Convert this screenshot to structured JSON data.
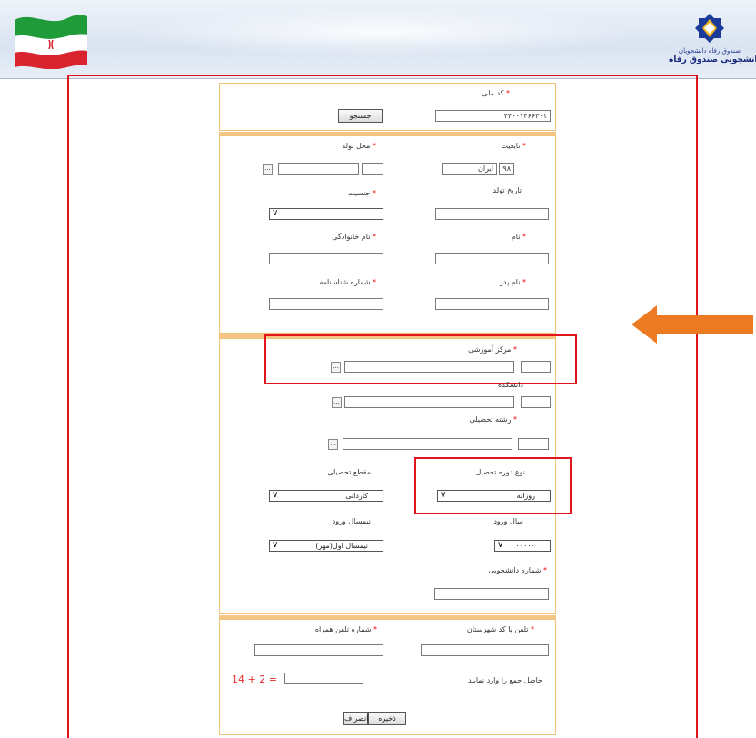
{
  "header": {
    "logo_line1": "صندوق رفاه دانشجویان",
    "logo_line2": "پورتال دانشجویی صندوق رفاه"
  },
  "search": {
    "national_code_label": "کد ملی",
    "national_code_value": "۰۴۴۰۰۱۴۶۶۳۰۱",
    "search_button": "جستجو"
  },
  "personal": {
    "nationality_label": "تابعیت",
    "nationality_code": "۹۸",
    "nationality_value": "ایران",
    "birthplace_label": "محل تولد",
    "birthdate_label": "تاریخ تولد",
    "gender_label": "جنسیت",
    "first_name_label": "نام",
    "last_name_label": "نام خانوادگی",
    "father_name_label": "نام پدر",
    "id_number_label": "شماره شناسنامه"
  },
  "education": {
    "center_label": "مرکز آموزشی",
    "faculty_label": "دانشکده",
    "major_label": "رشته تحصیلی",
    "course_type_label": "نوع دوره تحصیل",
    "course_type_value": "روزانه",
    "degree_label": "مقطع تحصیلی",
    "degree_value": "کاردانی",
    "entry_year_label": "سال ورود",
    "entry_year_value": "۰۰۰۰۰",
    "entry_semester_label": "نیمسال ورود",
    "entry_semester_value": "نیمسال اول(مهر)",
    "student_number_label": "شماره دانشجویی"
  },
  "contact": {
    "phone_label": "تلفن با کد شهرستان",
    "mobile_label": "شماره تلفن همراه",
    "captcha_label": "حاصل جمع را وارد نمایید",
    "captcha_expression": "14 + 2 ="
  },
  "actions": {
    "save": "ذخیره",
    "cancel": "انصراف"
  },
  "colors": {
    "annotation_red": "#e0141d",
    "arrow_orange": "#ec7a23",
    "section_border": "#f6c686"
  }
}
